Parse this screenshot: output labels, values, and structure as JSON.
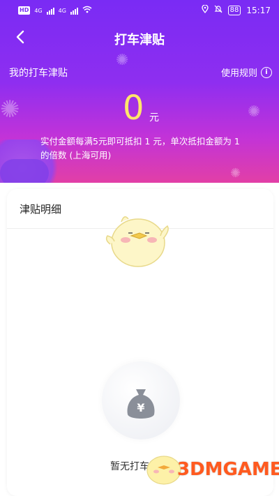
{
  "status_bar": {
    "network_left": "HD",
    "network_sub": "2",
    "signal_1": "4G",
    "signal_2": "4G",
    "battery": "88",
    "time": "15:17"
  },
  "nav": {
    "back_icon": "chevron-left-icon",
    "title": "打车津贴"
  },
  "summary": {
    "label": "我的打车津贴",
    "rules_label": "使用规则",
    "amount": "0",
    "unit": "元",
    "description": "实付金额每满5元即可抵扣 1 元，单次抵扣金额为 1 的倍数 (上海可用)"
  },
  "detail": {
    "title": "津贴明细",
    "empty_text": "暂无打车津贴"
  },
  "watermark": "3DMGAME",
  "colors": {
    "header_top": "#7a2bf4",
    "header_bottom": "#e23fa6",
    "amount": "#ffe66b",
    "watermark": "#ff5a1f"
  }
}
